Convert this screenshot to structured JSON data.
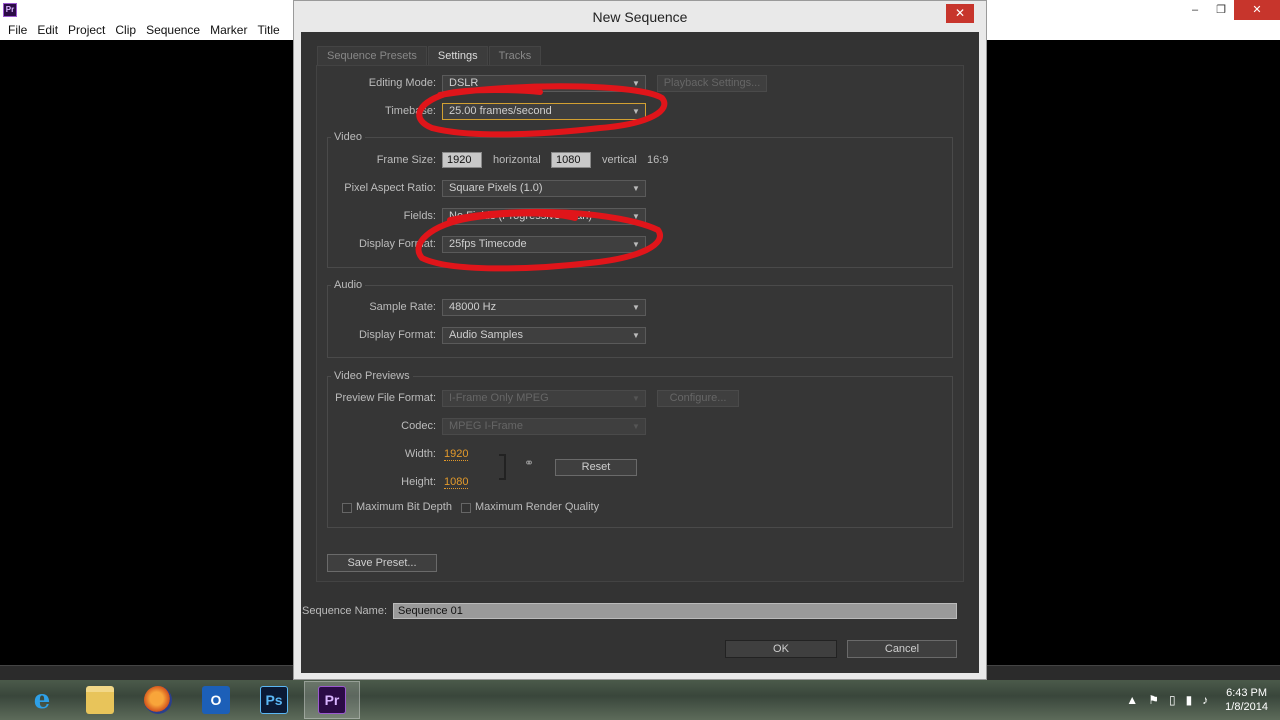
{
  "app": {
    "logo": "Pr",
    "menu": [
      "File",
      "Edit",
      "Project",
      "Clip",
      "Sequence",
      "Marker",
      "Title"
    ],
    "window_controls": {
      "minimize": "–",
      "restore": "❐",
      "close": "✕"
    }
  },
  "dialog": {
    "title": "New Sequence",
    "close_glyph": "✕",
    "tabs": [
      {
        "label": "Sequence Presets",
        "active": false
      },
      {
        "label": "Settings",
        "active": true
      },
      {
        "label": "Tracks",
        "active": false
      }
    ],
    "editing_mode": {
      "label": "Editing Mode:",
      "value": "DSLR"
    },
    "playback_settings_button": "Playback Settings...",
    "timebase": {
      "label": "Timebase:",
      "value": "25.00 frames/second"
    },
    "video": {
      "title": "Video",
      "frame_size": {
        "label": "Frame Size:",
        "horizontal": "1920",
        "horizontal_label": "horizontal",
        "vertical": "1080",
        "vertical_label": "vertical",
        "aspect": "16:9"
      },
      "pixel_aspect_ratio": {
        "label": "Pixel Aspect Ratio:",
        "value": "Square Pixels (1.0)"
      },
      "fields": {
        "label": "Fields:",
        "value": "No Fields (Progressive Scan)"
      },
      "display_format": {
        "label": "Display Format:",
        "value": "25fps Timecode"
      }
    },
    "audio": {
      "title": "Audio",
      "sample_rate": {
        "label": "Sample Rate:",
        "value": "48000 Hz"
      },
      "display_format": {
        "label": "Display Format:",
        "value": "Audio Samples"
      }
    },
    "video_previews": {
      "title": "Video Previews",
      "preview_file_format": {
        "label": "Preview File Format:",
        "value": "I-Frame Only MPEG"
      },
      "configure_button": "Configure...",
      "codec": {
        "label": "Codec:",
        "value": "MPEG I-Frame"
      },
      "width": {
        "label": "Width:",
        "value": "1920"
      },
      "height": {
        "label": "Height:",
        "value": "1080"
      },
      "reset_button": "Reset",
      "max_bit_depth": "Maximum Bit Depth",
      "max_render_quality": "Maximum Render Quality"
    },
    "save_preset_button": "Save Preset...",
    "sequence_name": {
      "label": "Sequence Name:",
      "value": "Sequence 01"
    },
    "ok_button": "OK",
    "cancel_button": "Cancel"
  },
  "taskbar": {
    "apps": [
      {
        "name": "internet-explorer",
        "glyph": "e"
      },
      {
        "name": "file-explorer",
        "glyph": ""
      },
      {
        "name": "firefox",
        "glyph": ""
      },
      {
        "name": "outlook",
        "glyph": "O"
      },
      {
        "name": "photoshop",
        "glyph": "Ps"
      },
      {
        "name": "premiere",
        "glyph": "Pr"
      }
    ],
    "clock_time": "6:43 PM",
    "clock_date": "1/8/2014"
  },
  "colors": {
    "annotation_red": "#e0151a",
    "accent_orange": "#e39a2b"
  }
}
